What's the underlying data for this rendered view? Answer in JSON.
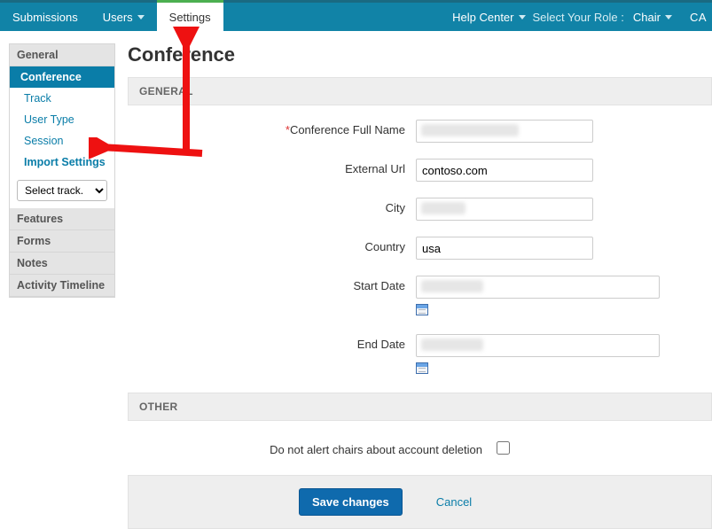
{
  "topnav": {
    "submissions": "Submissions",
    "users": "Users",
    "settings": "Settings",
    "help_center": "Help Center",
    "role_label": "Select Your Role :",
    "role_value": "Chair",
    "ca": "CA"
  },
  "sidebar": {
    "group_general": "General",
    "items": {
      "conference": "Conference",
      "track": "Track",
      "user_type": "User Type",
      "session": "Session",
      "import_settings": "Import Settings"
    },
    "select_placeholder": "Select track.",
    "group_features": "Features",
    "group_forms": "Forms",
    "group_notes": "Notes",
    "group_activity": "Activity Timeline"
  },
  "page": {
    "title": "Conference",
    "section_general": "GENERAL",
    "section_other": "OTHER",
    "labels": {
      "full_name": "Conference Full Name",
      "external_url": "External Url",
      "city": "City",
      "country": "Country",
      "start_date": "Start Date",
      "end_date": "End Date",
      "no_alert": "Do not alert chairs about account deletion"
    },
    "values": {
      "full_name": "",
      "external_url": "contoso.com",
      "city": "",
      "country": "usa",
      "start_date": "",
      "end_date": ""
    },
    "actions": {
      "save": "Save changes",
      "cancel": "Cancel"
    }
  }
}
